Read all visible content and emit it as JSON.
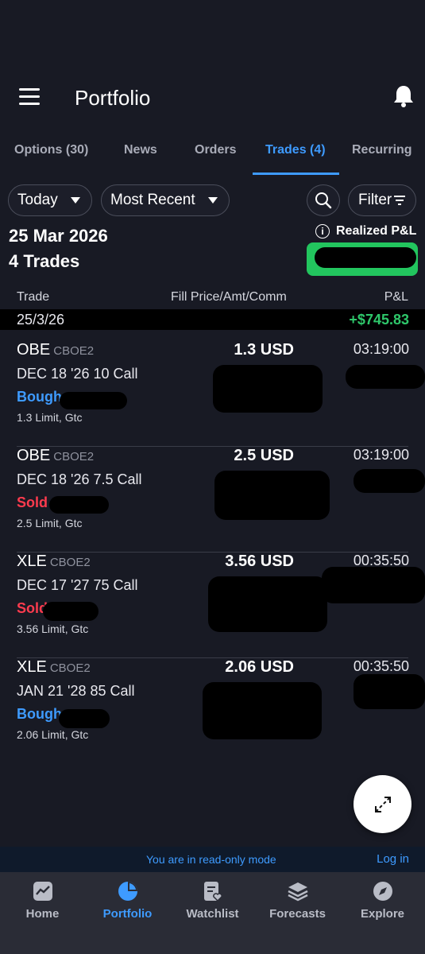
{
  "header": {
    "title": "Portfolio"
  },
  "tabs": [
    {
      "label": "Options (30)"
    },
    {
      "label": "News"
    },
    {
      "label": "Orders"
    },
    {
      "label": "Trades (4)",
      "active": true
    },
    {
      "label": "Recurring"
    }
  ],
  "filters": {
    "period": "Today",
    "sort": "Most Recent",
    "filter_label": "Filter"
  },
  "summary": {
    "date": "25 Mar 2026",
    "count_label": "4 Trades",
    "realized_label": "Realized P&L",
    "info_glyph": "i"
  },
  "columns": {
    "trade": "Trade",
    "fill": "Fill Price/Amt/Comm",
    "pnl": "P&L"
  },
  "group": {
    "date": "25/3/26",
    "pnl": "+$745.83"
  },
  "trades": [
    {
      "symbol": "OBE",
      "exchange": "CBOE2",
      "contract": "DEC 18 '26 10 Call",
      "side": "Bough",
      "side_type": "buy",
      "order": "1.3 Limit, Gtc",
      "price": "1.3 USD",
      "time": "03:19:00"
    },
    {
      "symbol": "OBE",
      "exchange": "CBOE2",
      "contract": "DEC 18 '26 7.5 Call",
      "side": "Sold",
      "side_type": "sell",
      "order": "2.5 Limit, Gtc",
      "price": "2.5 USD",
      "time": "03:19:00"
    },
    {
      "symbol": "XLE",
      "exchange": "CBOE2",
      "contract": "DEC 17 '27 75 Call",
      "side": "Sold",
      "side_type": "sell",
      "order": "3.56 Limit, Gtc",
      "price": "3.56 USD",
      "time": "00:35:50"
    },
    {
      "symbol": "XLE",
      "exchange": "CBOE2",
      "contract": "JAN 21 '28 85 Call",
      "side": "Bough",
      "side_type": "buy",
      "order": "2.06 Limit, Gtc",
      "price": "2.06 USD",
      "time": "00:35:50"
    }
  ],
  "readonly": {
    "message": "You are in read-only mode",
    "login": "Log in"
  },
  "nav": [
    {
      "label": "Home",
      "icon": "home-chart-icon"
    },
    {
      "label": "Portfolio",
      "icon": "pie-chart-icon",
      "active": true
    },
    {
      "label": "Watchlist",
      "icon": "watchlist-icon"
    },
    {
      "label": "Forecasts",
      "icon": "layers-icon"
    },
    {
      "label": "Explore",
      "icon": "compass-icon"
    }
  ],
  "colors": {
    "accent": "#3e9bff",
    "profit": "#2ec76a",
    "sell": "#ff3b4e",
    "badge": "#22c55e"
  }
}
